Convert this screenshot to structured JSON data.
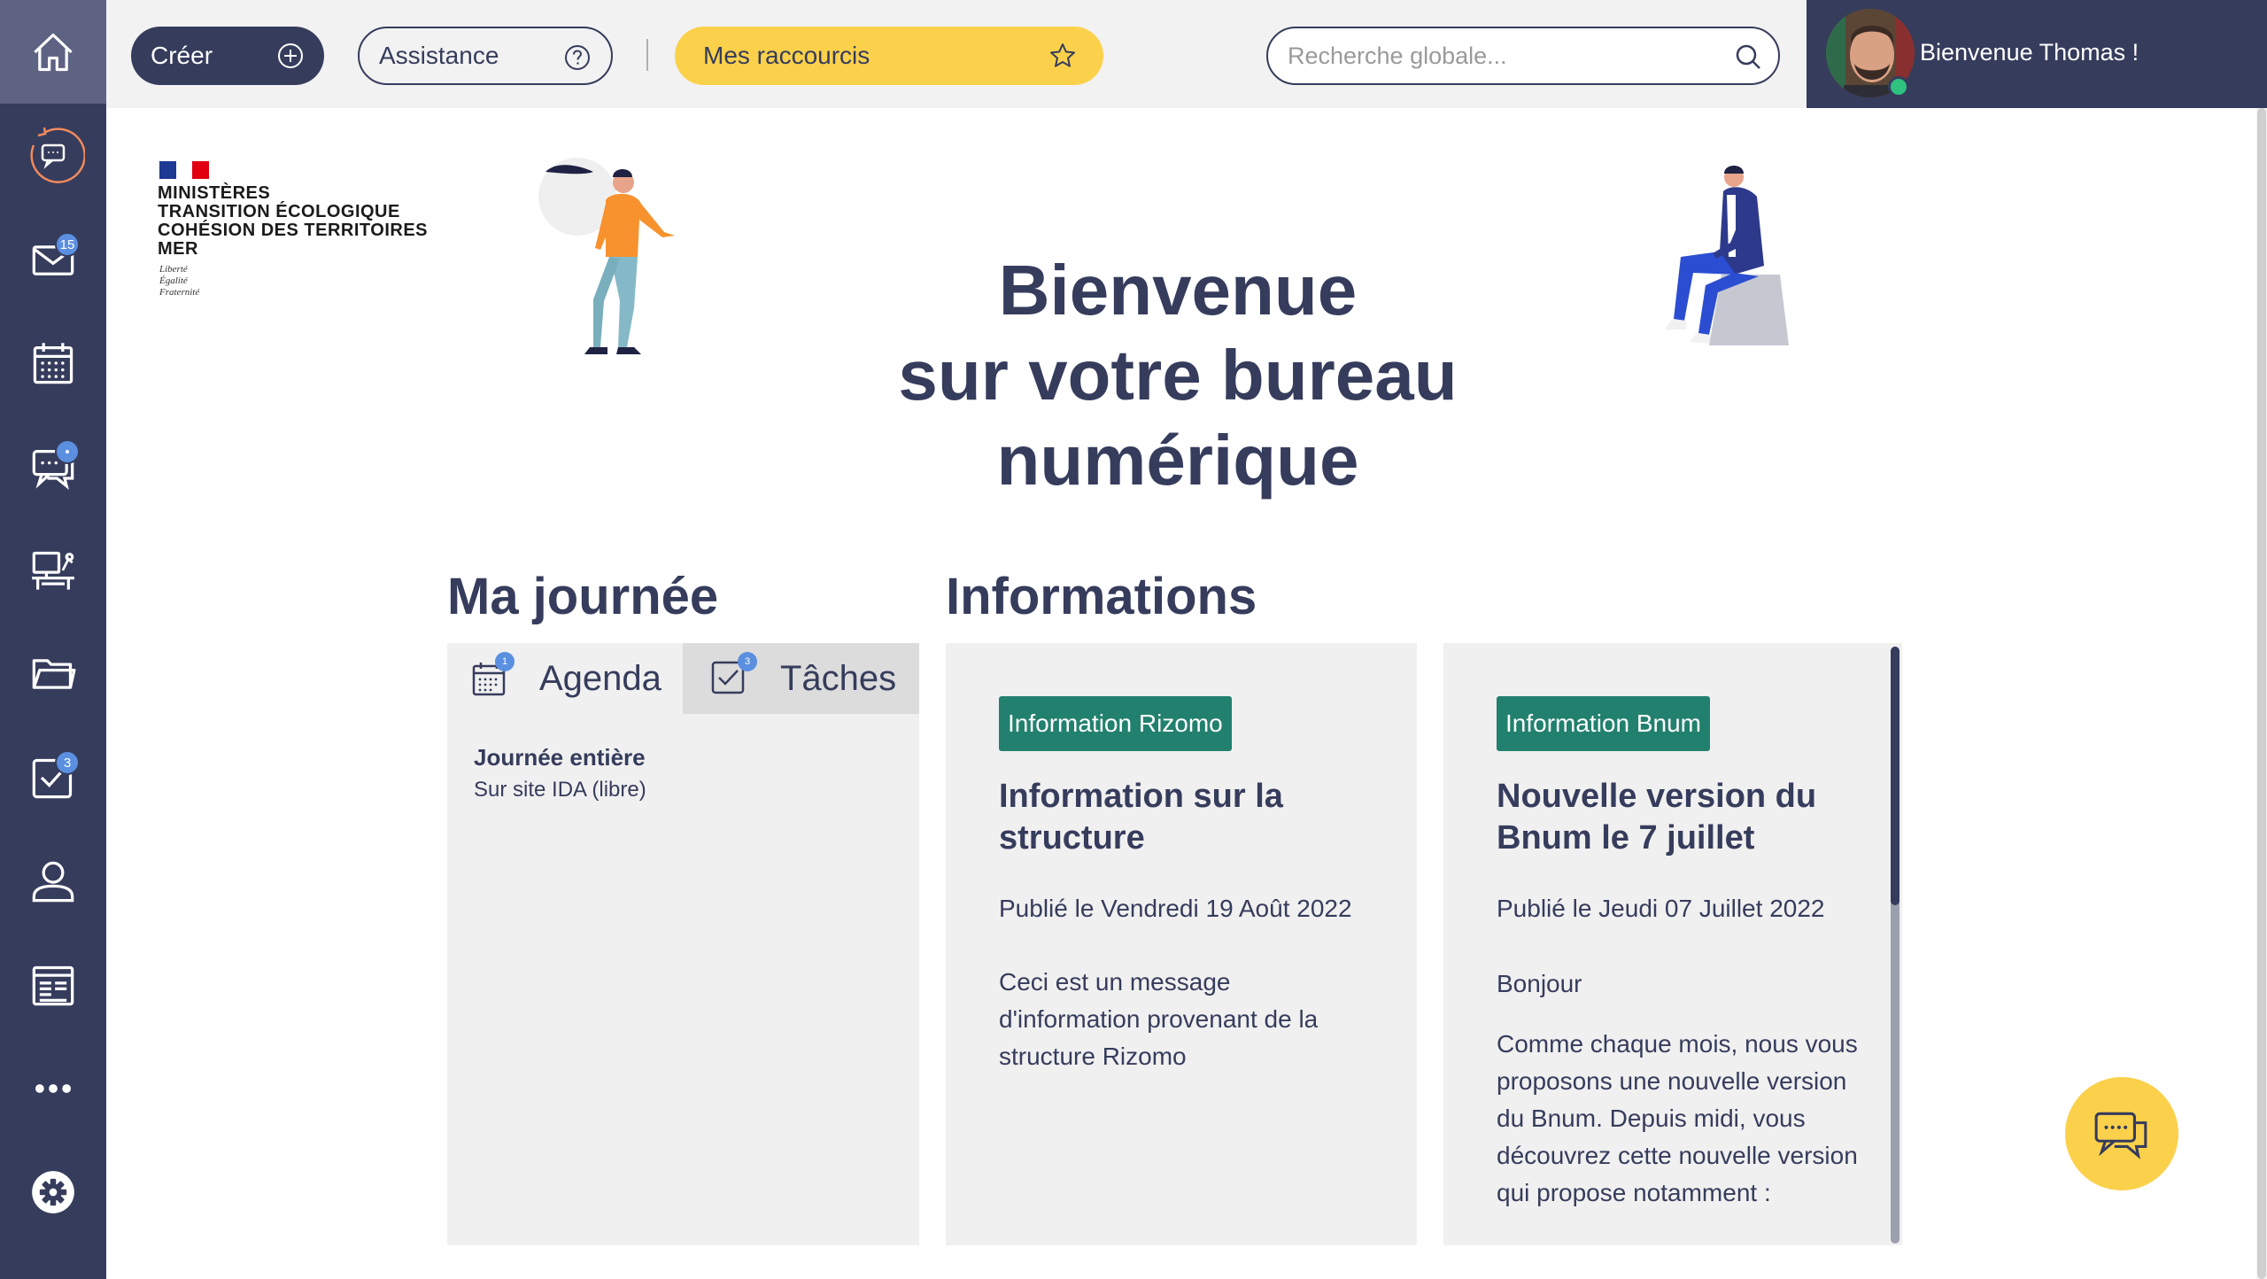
{
  "sidebar": {
    "items": [
      {
        "name": "home",
        "icon": "home-icon"
      },
      {
        "name": "chat-history",
        "icon": "chat-refresh-icon"
      },
      {
        "name": "mail",
        "icon": "mail-icon",
        "badge": "15"
      },
      {
        "name": "calendar",
        "icon": "calendar-icon"
      },
      {
        "name": "messaging",
        "icon": "chat-icon",
        "badge": "•"
      },
      {
        "name": "workspace",
        "icon": "desk-icon"
      },
      {
        "name": "documents",
        "icon": "folder-icon"
      },
      {
        "name": "tasks",
        "icon": "task-check-icon",
        "badge": "3"
      },
      {
        "name": "contacts",
        "icon": "user-icon"
      },
      {
        "name": "news",
        "icon": "news-icon"
      },
      {
        "name": "more",
        "icon": "more-dots-icon"
      },
      {
        "name": "settings",
        "icon": "gear-icon"
      }
    ]
  },
  "topbar": {
    "create_label": "Créer",
    "assist_label": "Assistance",
    "shortcuts_label": "Mes raccourcis",
    "search_placeholder": "Recherche globale..."
  },
  "user": {
    "welcome": "Bienvenue Thomas !"
  },
  "logo": {
    "lines": [
      "MINISTÈRES",
      "TRANSITION ÉCOLOGIQUE",
      "COHÉSION DES TERRITOIRES",
      "MER"
    ],
    "motto": [
      "Liberté",
      "Égalité",
      "Fraternité"
    ]
  },
  "hero": {
    "line1": "Bienvenue",
    "line2": "sur votre bureau",
    "line3": "numérique"
  },
  "my_day": {
    "title": "Ma journée",
    "tab_agenda": "Agenda",
    "tab_tasks": "Tâches",
    "agenda_badge": "1",
    "tasks_badge": "3",
    "event_title": "Journée entière",
    "event_sub": "Sur site IDA (libre)"
  },
  "informations": {
    "title": "Informations",
    "cards": [
      {
        "tag": "Information Rizomo",
        "title": "Information sur la structure",
        "date": "Publié le Vendredi 19 Août 2022",
        "body": "Ceci est un message d'information provenant de la structure Rizomo"
      },
      {
        "tag": "Information Bnum",
        "title": "Nouvelle version du Bnum le 7 juillet",
        "date": "Publié le Jeudi 07 Juillet 2022",
        "greeting": "Bonjour",
        "body": "Comme chaque mois, nous vous proposons une nouvelle version du Bnum. Depuis midi, vous découvrez cette nouvelle version qui propose notamment :"
      }
    ]
  },
  "colors": {
    "navy": "#363c5c",
    "accent_yellow": "#fbd14b",
    "tag_green": "#22806e",
    "badge_blue": "#5b8fe0",
    "panel_grey": "#f0f0f0"
  }
}
